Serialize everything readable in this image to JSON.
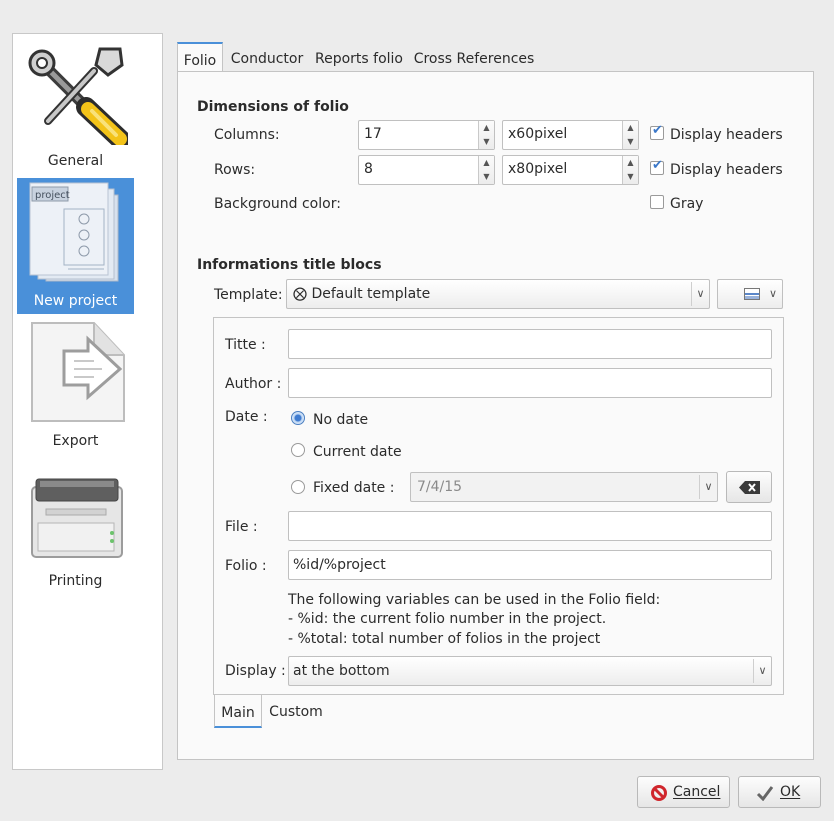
{
  "sidebar": {
    "items": [
      {
        "label": "General",
        "icon": "tools-icon"
      },
      {
        "label": "New project",
        "icon": "project-icon",
        "selected": true
      },
      {
        "label": "Export",
        "icon": "export-icon"
      },
      {
        "label": "Printing",
        "icon": "printer-icon"
      }
    ],
    "project_icon_text": "project"
  },
  "tabs": [
    {
      "label": "Folio",
      "active": true
    },
    {
      "label": "Conductor"
    },
    {
      "label": "Reports folio"
    },
    {
      "label": "Cross References"
    }
  ],
  "dimensions": {
    "title": "Dimensions of folio",
    "columns_label": "Columns:",
    "columns_value": "17",
    "columns_size": "x60pixel",
    "rows_label": "Rows:",
    "rows_value": "8",
    "rows_size": "x80pixel",
    "display_headers_label": "Display headers",
    "columns_headers_checked": true,
    "rows_headers_checked": true,
    "bg_color_label": "Background color:",
    "gray_label": "Gray",
    "gray_checked": false
  },
  "titleblock": {
    "title": "Informations title blocs",
    "template_label": "Template:",
    "template_value": "Default template",
    "title_label": "Titte :",
    "title_value": "",
    "author_label": "Author :",
    "author_value": "",
    "date_label": "Date :",
    "no_date_label": "No date",
    "current_date_label": "Current date",
    "fixed_date_label": "Fixed date :",
    "fixed_date_value": "7/4/15",
    "date_selected": "no_date",
    "file_label": "File :",
    "file_value": "",
    "folio_label": "Folio :",
    "folio_value": "%id/%project",
    "help_line1": "The following variables can be used in the Folio field:",
    "help_line2": "- %id: the current folio number in the project.",
    "help_line3": "- %total: total number of folios in the project",
    "display_label": "Display :",
    "display_value": "at the bottom",
    "subtabs": [
      {
        "label": "Main",
        "active": true
      },
      {
        "label": "Custom"
      }
    ]
  },
  "buttons": {
    "cancel_label": "Cancel",
    "ok_label": "OK"
  },
  "colors": {
    "accent": "#4a90d9",
    "cancel_icon": "#d0262c"
  }
}
